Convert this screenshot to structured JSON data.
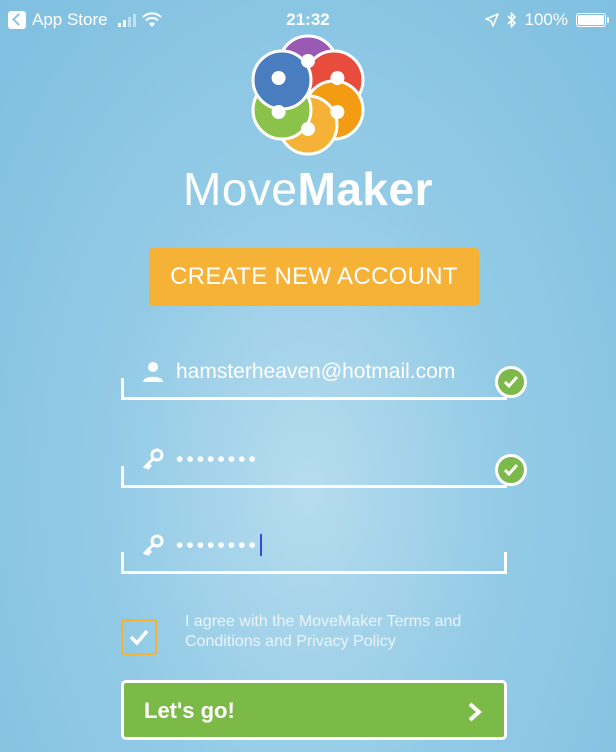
{
  "status_bar": {
    "back_app": "App Store",
    "time": "21:32",
    "battery": "100%"
  },
  "brand": {
    "name_light": "Move",
    "name_bold": "Maker",
    "colors": [
      "#9b59b6",
      "#e74c3c",
      "#f39c12",
      "#f5b236",
      "#8bc34a",
      "#4a7dbf"
    ]
  },
  "create_account": {
    "label": "CREATE NEW ACCOUNT"
  },
  "form": {
    "email": {
      "value": "hamsterheaven@hotmail.com",
      "icon": "user-icon",
      "valid": true
    },
    "password": {
      "value": "••••••••",
      "icon": "key-icon",
      "valid": true
    },
    "confirm_password": {
      "value": "••••••••",
      "icon": "key-icon"
    }
  },
  "agree": {
    "checked": true,
    "text": "I agree with the MoveMaker Terms and Conditions and Privacy Policy"
  },
  "submit": {
    "label": "Let's go!"
  },
  "colors": {
    "accent": "#f5b236",
    "success": "#7cba48",
    "background": "#93cbe6"
  }
}
